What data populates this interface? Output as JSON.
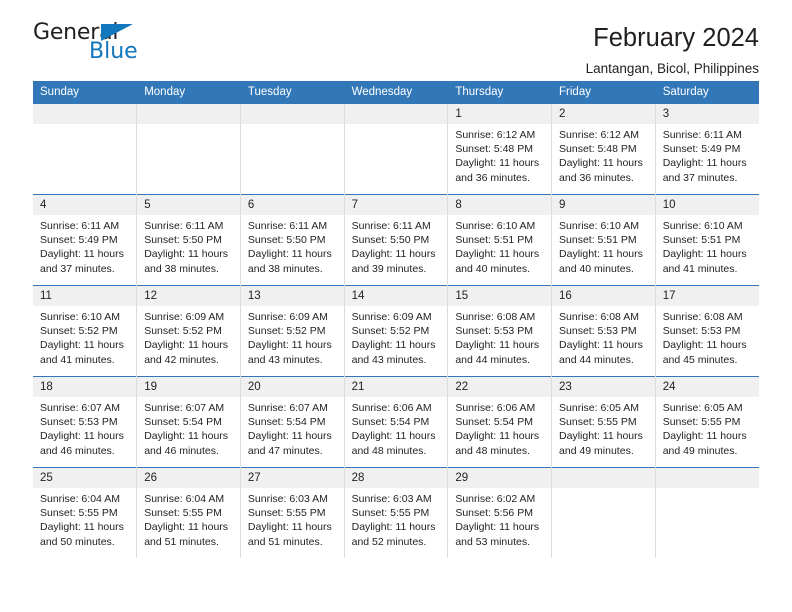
{
  "logo": {
    "word_one": "General",
    "word_two": "Blue",
    "triangle_icon": "triangle-icon",
    "brand_color": "#1277bc"
  },
  "header": {
    "title": "February 2024",
    "subtitle": "Lantangan, Bicol, Philippines"
  },
  "theme": {
    "header_row_bg": "#3277b8",
    "daynum_bg": "#f0f0f0",
    "text_color": "#231f20",
    "cell_divider": "#dcdcdc"
  },
  "calendar": {
    "weekday_headers": [
      "Sunday",
      "Monday",
      "Tuesday",
      "Wednesday",
      "Thursday",
      "Friday",
      "Saturday"
    ],
    "weeks": [
      [
        {
          "day": "",
          "empty": true
        },
        {
          "day": "",
          "empty": true
        },
        {
          "day": "",
          "empty": true
        },
        {
          "day": "",
          "empty": true
        },
        {
          "day": "1",
          "sunrise": "Sunrise: 6:12 AM",
          "sunset": "Sunset: 5:48 PM",
          "daylight_line1": "Daylight: 11 hours",
          "daylight_line2": "and 36 minutes."
        },
        {
          "day": "2",
          "sunrise": "Sunrise: 6:12 AM",
          "sunset": "Sunset: 5:48 PM",
          "daylight_line1": "Daylight: 11 hours",
          "daylight_line2": "and 36 minutes."
        },
        {
          "day": "3",
          "sunrise": "Sunrise: 6:11 AM",
          "sunset": "Sunset: 5:49 PM",
          "daylight_line1": "Daylight: 11 hours",
          "daylight_line2": "and 37 minutes."
        }
      ],
      [
        {
          "day": "4",
          "sunrise": "Sunrise: 6:11 AM",
          "sunset": "Sunset: 5:49 PM",
          "daylight_line1": "Daylight: 11 hours",
          "daylight_line2": "and 37 minutes."
        },
        {
          "day": "5",
          "sunrise": "Sunrise: 6:11 AM",
          "sunset": "Sunset: 5:50 PM",
          "daylight_line1": "Daylight: 11 hours",
          "daylight_line2": "and 38 minutes."
        },
        {
          "day": "6",
          "sunrise": "Sunrise: 6:11 AM",
          "sunset": "Sunset: 5:50 PM",
          "daylight_line1": "Daylight: 11 hours",
          "daylight_line2": "and 38 minutes."
        },
        {
          "day": "7",
          "sunrise": "Sunrise: 6:11 AM",
          "sunset": "Sunset: 5:50 PM",
          "daylight_line1": "Daylight: 11 hours",
          "daylight_line2": "and 39 minutes."
        },
        {
          "day": "8",
          "sunrise": "Sunrise: 6:10 AM",
          "sunset": "Sunset: 5:51 PM",
          "daylight_line1": "Daylight: 11 hours",
          "daylight_line2": "and 40 minutes."
        },
        {
          "day": "9",
          "sunrise": "Sunrise: 6:10 AM",
          "sunset": "Sunset: 5:51 PM",
          "daylight_line1": "Daylight: 11 hours",
          "daylight_line2": "and 40 minutes."
        },
        {
          "day": "10",
          "sunrise": "Sunrise: 6:10 AM",
          "sunset": "Sunset: 5:51 PM",
          "daylight_line1": "Daylight: 11 hours",
          "daylight_line2": "and 41 minutes."
        }
      ],
      [
        {
          "day": "11",
          "sunrise": "Sunrise: 6:10 AM",
          "sunset": "Sunset: 5:52 PM",
          "daylight_line1": "Daylight: 11 hours",
          "daylight_line2": "and 41 minutes."
        },
        {
          "day": "12",
          "sunrise": "Sunrise: 6:09 AM",
          "sunset": "Sunset: 5:52 PM",
          "daylight_line1": "Daylight: 11 hours",
          "daylight_line2": "and 42 minutes."
        },
        {
          "day": "13",
          "sunrise": "Sunrise: 6:09 AM",
          "sunset": "Sunset: 5:52 PM",
          "daylight_line1": "Daylight: 11 hours",
          "daylight_line2": "and 43 minutes."
        },
        {
          "day": "14",
          "sunrise": "Sunrise: 6:09 AM",
          "sunset": "Sunset: 5:52 PM",
          "daylight_line1": "Daylight: 11 hours",
          "daylight_line2": "and 43 minutes."
        },
        {
          "day": "15",
          "sunrise": "Sunrise: 6:08 AM",
          "sunset": "Sunset: 5:53 PM",
          "daylight_line1": "Daylight: 11 hours",
          "daylight_line2": "and 44 minutes."
        },
        {
          "day": "16",
          "sunrise": "Sunrise: 6:08 AM",
          "sunset": "Sunset: 5:53 PM",
          "daylight_line1": "Daylight: 11 hours",
          "daylight_line2": "and 44 minutes."
        },
        {
          "day": "17",
          "sunrise": "Sunrise: 6:08 AM",
          "sunset": "Sunset: 5:53 PM",
          "daylight_line1": "Daylight: 11 hours",
          "daylight_line2": "and 45 minutes."
        }
      ],
      [
        {
          "day": "18",
          "sunrise": "Sunrise: 6:07 AM",
          "sunset": "Sunset: 5:53 PM",
          "daylight_line1": "Daylight: 11 hours",
          "daylight_line2": "and 46 minutes."
        },
        {
          "day": "19",
          "sunrise": "Sunrise: 6:07 AM",
          "sunset": "Sunset: 5:54 PM",
          "daylight_line1": "Daylight: 11 hours",
          "daylight_line2": "and 46 minutes."
        },
        {
          "day": "20",
          "sunrise": "Sunrise: 6:07 AM",
          "sunset": "Sunset: 5:54 PM",
          "daylight_line1": "Daylight: 11 hours",
          "daylight_line2": "and 47 minutes."
        },
        {
          "day": "21",
          "sunrise": "Sunrise: 6:06 AM",
          "sunset": "Sunset: 5:54 PM",
          "daylight_line1": "Daylight: 11 hours",
          "daylight_line2": "and 48 minutes."
        },
        {
          "day": "22",
          "sunrise": "Sunrise: 6:06 AM",
          "sunset": "Sunset: 5:54 PM",
          "daylight_line1": "Daylight: 11 hours",
          "daylight_line2": "and 48 minutes."
        },
        {
          "day": "23",
          "sunrise": "Sunrise: 6:05 AM",
          "sunset": "Sunset: 5:55 PM",
          "daylight_line1": "Daylight: 11 hours",
          "daylight_line2": "and 49 minutes."
        },
        {
          "day": "24",
          "sunrise": "Sunrise: 6:05 AM",
          "sunset": "Sunset: 5:55 PM",
          "daylight_line1": "Daylight: 11 hours",
          "daylight_line2": "and 49 minutes."
        }
      ],
      [
        {
          "day": "25",
          "sunrise": "Sunrise: 6:04 AM",
          "sunset": "Sunset: 5:55 PM",
          "daylight_line1": "Daylight: 11 hours",
          "daylight_line2": "and 50 minutes."
        },
        {
          "day": "26",
          "sunrise": "Sunrise: 6:04 AM",
          "sunset": "Sunset: 5:55 PM",
          "daylight_line1": "Daylight: 11 hours",
          "daylight_line2": "and 51 minutes."
        },
        {
          "day": "27",
          "sunrise": "Sunrise: 6:03 AM",
          "sunset": "Sunset: 5:55 PM",
          "daylight_line1": "Daylight: 11 hours",
          "daylight_line2": "and 51 minutes."
        },
        {
          "day": "28",
          "sunrise": "Sunrise: 6:03 AM",
          "sunset": "Sunset: 5:55 PM",
          "daylight_line1": "Daylight: 11 hours",
          "daylight_line2": "and 52 minutes."
        },
        {
          "day": "29",
          "sunrise": "Sunrise: 6:02 AM",
          "sunset": "Sunset: 5:56 PM",
          "daylight_line1": "Daylight: 11 hours",
          "daylight_line2": "and 53 minutes."
        },
        {
          "day": "",
          "empty": true
        },
        {
          "day": "",
          "empty": true
        }
      ]
    ]
  }
}
